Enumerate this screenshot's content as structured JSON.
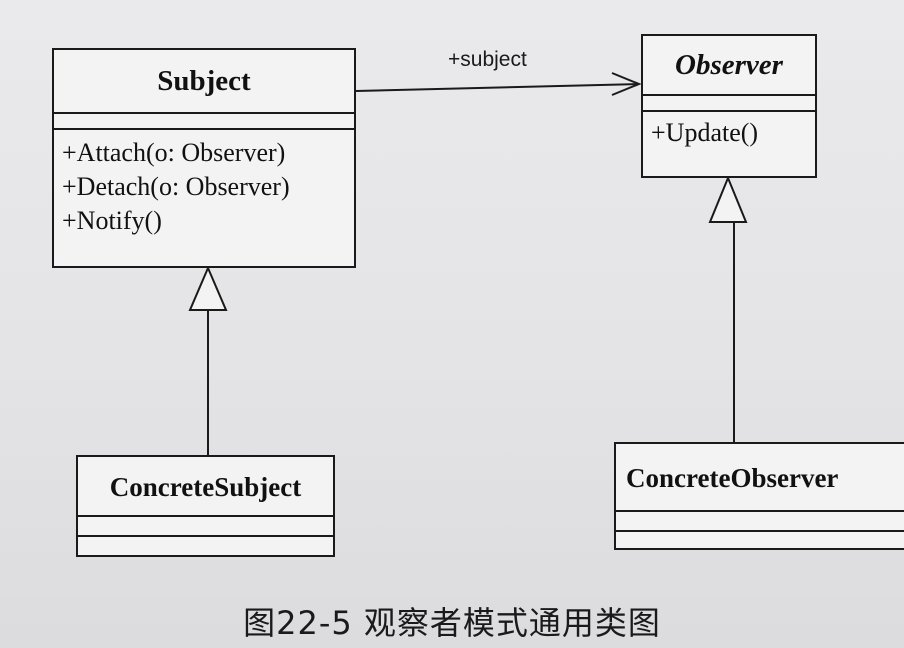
{
  "diagram": {
    "classes": {
      "subject": {
        "name": "Subject",
        "operations": [
          "+Attach(o: Observer)",
          "+Detach(o: Observer)",
          "+Notify()"
        ]
      },
      "observer": {
        "name": "Observer",
        "operations": [
          "+Update()"
        ]
      },
      "concrete_subject": {
        "name": "ConcreteSubject",
        "operations": []
      },
      "concrete_observer": {
        "name": "ConcreteObserver",
        "operations": []
      }
    },
    "association_label": "+subject",
    "relationships": [
      {
        "type": "association",
        "from": "Subject",
        "to": "Observer",
        "label": "+subject"
      },
      {
        "type": "generalization",
        "from": "ConcreteSubject",
        "to": "Subject"
      },
      {
        "type": "generalization",
        "from": "ConcreteObserver",
        "to": "Observer"
      }
    ]
  },
  "caption": "图22-5   观察者模式通用类图"
}
